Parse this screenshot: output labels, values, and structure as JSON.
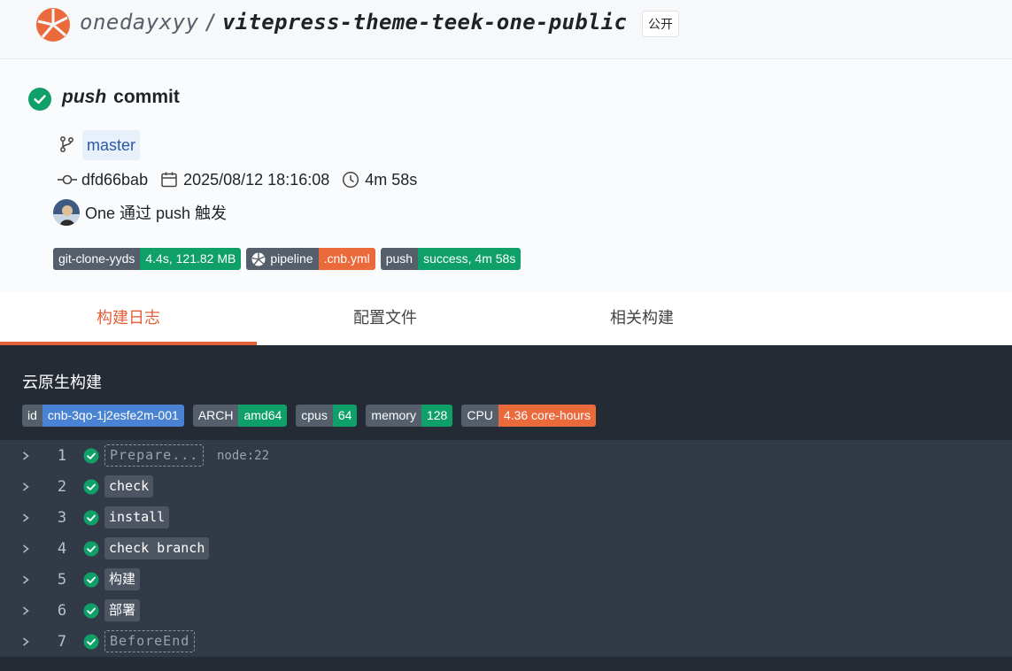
{
  "header": {
    "owner": "onedayxyy",
    "separator": "/",
    "repo": "vitepress-theme-teek-one-public",
    "visibility": "公开"
  },
  "commit": {
    "event": "push",
    "title": "commit",
    "branch": "master",
    "sha": "dfd66bab",
    "datetime": "2025/08/12 18:16:08",
    "duration": "4m 58s",
    "trigger": "One 通过 push 触发"
  },
  "status_badges": [
    {
      "label": "git-clone-yyds",
      "value": "4.4s, 121.82 MB",
      "color": "#0fa06a"
    },
    {
      "label": "pipeline",
      "value": ".cnb.yml",
      "color": "#ea6a3c"
    },
    {
      "label": "push",
      "value": "success, 4m 58s",
      "color": "#0fa06a"
    }
  ],
  "tabs": [
    {
      "label": "构建日志",
      "active": true
    },
    {
      "label": "配置文件",
      "active": false
    },
    {
      "label": "相关构建",
      "active": false
    }
  ],
  "build": {
    "title": "云原生构建",
    "badges": [
      {
        "label": "id",
        "value": "cnb-3qo-1j2esfe2m-001",
        "color": "#4b83d4"
      },
      {
        "label": "ARCH",
        "value": "amd64",
        "color": "#0fa06a"
      },
      {
        "label": "cpus",
        "value": "64",
        "color": "#0fa06a"
      },
      {
        "label": "memory",
        "value": "128",
        "color": "#0fa06a"
      },
      {
        "label": "CPU",
        "value": "4.36 core-hours",
        "color": "#ea6a3c"
      }
    ],
    "steps": [
      {
        "num": "1",
        "name": "Prepare...",
        "note": "node:22",
        "style": "dashed"
      },
      {
        "num": "2",
        "name": "check",
        "note": "",
        "style": "solid"
      },
      {
        "num": "3",
        "name": "install",
        "note": "",
        "style": "solid"
      },
      {
        "num": "4",
        "name": "check branch",
        "note": "",
        "style": "solid"
      },
      {
        "num": "5",
        "name": "构建",
        "note": "",
        "style": "solid"
      },
      {
        "num": "6",
        "name": "部署",
        "note": "",
        "style": "solid"
      },
      {
        "num": "7",
        "name": "BeforeEnd",
        "note": "",
        "style": "dashed"
      }
    ]
  },
  "icons": {
    "logo": "cnb-logo-icon",
    "status": "check-circle-icon",
    "branch": "git-branch-icon",
    "commit": "git-commit-icon",
    "calendar": "calendar-icon",
    "clock": "clock-icon",
    "expand": "chevron-right-icon"
  }
}
